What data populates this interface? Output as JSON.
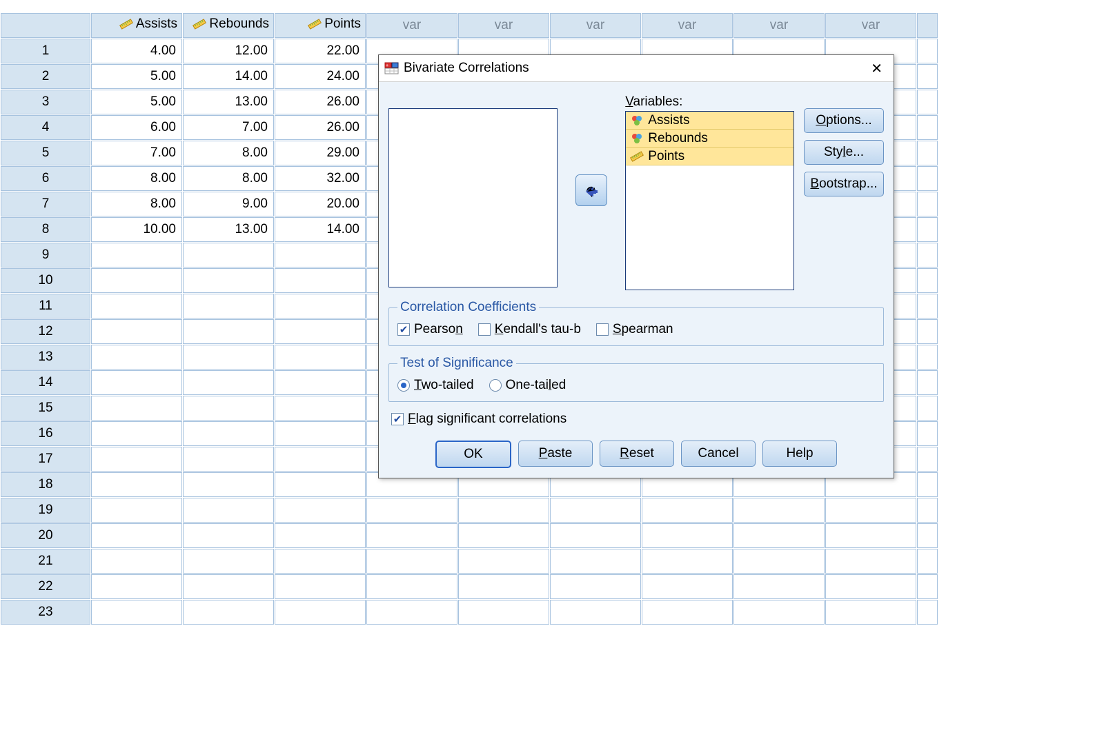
{
  "sheet": {
    "columns": [
      {
        "name": "Assists",
        "type": "scale"
      },
      {
        "name": "Rebounds",
        "type": "scale"
      },
      {
        "name": "Points",
        "type": "scale"
      }
    ],
    "auto_col_label": "var",
    "auto_col_count": 6,
    "row_count": 23,
    "data": [
      {
        "Assists": "4.00",
        "Rebounds": "12.00",
        "Points": "22.00"
      },
      {
        "Assists": "5.00",
        "Rebounds": "14.00",
        "Points": "24.00"
      },
      {
        "Assists": "5.00",
        "Rebounds": "13.00",
        "Points": "26.00"
      },
      {
        "Assists": "6.00",
        "Rebounds": "7.00",
        "Points": "26.00"
      },
      {
        "Assists": "7.00",
        "Rebounds": "8.00",
        "Points": "29.00"
      },
      {
        "Assists": "8.00",
        "Rebounds": "8.00",
        "Points": "32.00"
      },
      {
        "Assists": "8.00",
        "Rebounds": "9.00",
        "Points": "20.00"
      },
      {
        "Assists": "10.00",
        "Rebounds": "13.00",
        "Points": "14.00"
      }
    ]
  },
  "dialog": {
    "title": "Bivariate Correlations",
    "variables_label_pre": "V",
    "variables_label_post": "ariables:",
    "variables": [
      "Assists",
      "Rebounds",
      "Points"
    ],
    "side_buttons": {
      "options_pre": "O",
      "options_post": "ptions...",
      "style_pre": "Sty",
      "style_u": "l",
      "style_post": "e...",
      "bootstrap_pre": "",
      "bootstrap_u": "B",
      "bootstrap_post": "ootstrap..."
    },
    "groups": {
      "coef_legend": "Correlation Coefficients",
      "pearson_pre": "Pearso",
      "pearson_u": "n",
      "pearson_post": "",
      "kendall_pre": "",
      "kendall_u": "K",
      "kendall_post": "endall's tau-b",
      "spearman_pre": "",
      "spearman_u": "S",
      "spearman_post": "pearman",
      "sig_legend": "Test of Significance",
      "two_pre": "",
      "two_u": "T",
      "two_post": "wo-tailed",
      "one_pre": "One-tai",
      "one_u": "l",
      "one_post": "ed"
    },
    "flag_pre": "",
    "flag_u": "F",
    "flag_post": "lag significant correlations",
    "buttons": {
      "ok": "OK",
      "paste_pre": "",
      "paste_u": "P",
      "paste_post": "aste",
      "reset_pre": "",
      "reset_u": "R",
      "reset_post": "eset",
      "cancel": "Cancel",
      "help": "Help"
    }
  }
}
